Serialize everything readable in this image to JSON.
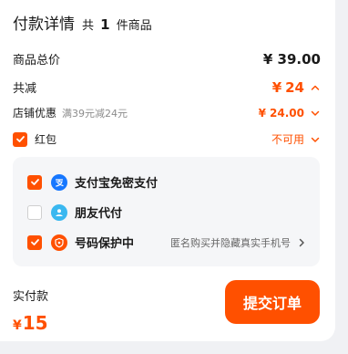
{
  "header": {
    "title": "付款详情",
    "prefix": "共",
    "count": "1",
    "suffix": "件商品"
  },
  "total": {
    "label": "商品总价",
    "currency": "¥",
    "amount": "39.00"
  },
  "discount": {
    "label": "共减",
    "currency": "¥",
    "amount": "24"
  },
  "shop_discount": {
    "label": "店铺优惠",
    "note": "满39元减24元",
    "currency": "¥",
    "amount": "24.00"
  },
  "red_packet": {
    "label": "红包",
    "status": "不可用",
    "checked": true
  },
  "options": [
    {
      "label": "支付宝免密支付",
      "icon": "alipay-icon",
      "checked": true,
      "note": ""
    },
    {
      "label": "朋友代付",
      "icon": "friend-pay-icon",
      "checked": false,
      "note": ""
    },
    {
      "label": "号码保护中",
      "icon": "phone-protection-icon",
      "checked": true,
      "note": "匿名购买并隐藏真实手机号"
    }
  ],
  "footer": {
    "pay_label": "实付款",
    "currency": "¥",
    "amount": "15",
    "submit_label": "提交订单"
  },
  "colors": {
    "accent": "#ff5000",
    "alipay": "#1677ff",
    "friend": "#3ab8f0",
    "panel_bg": "#f5f6f8"
  }
}
